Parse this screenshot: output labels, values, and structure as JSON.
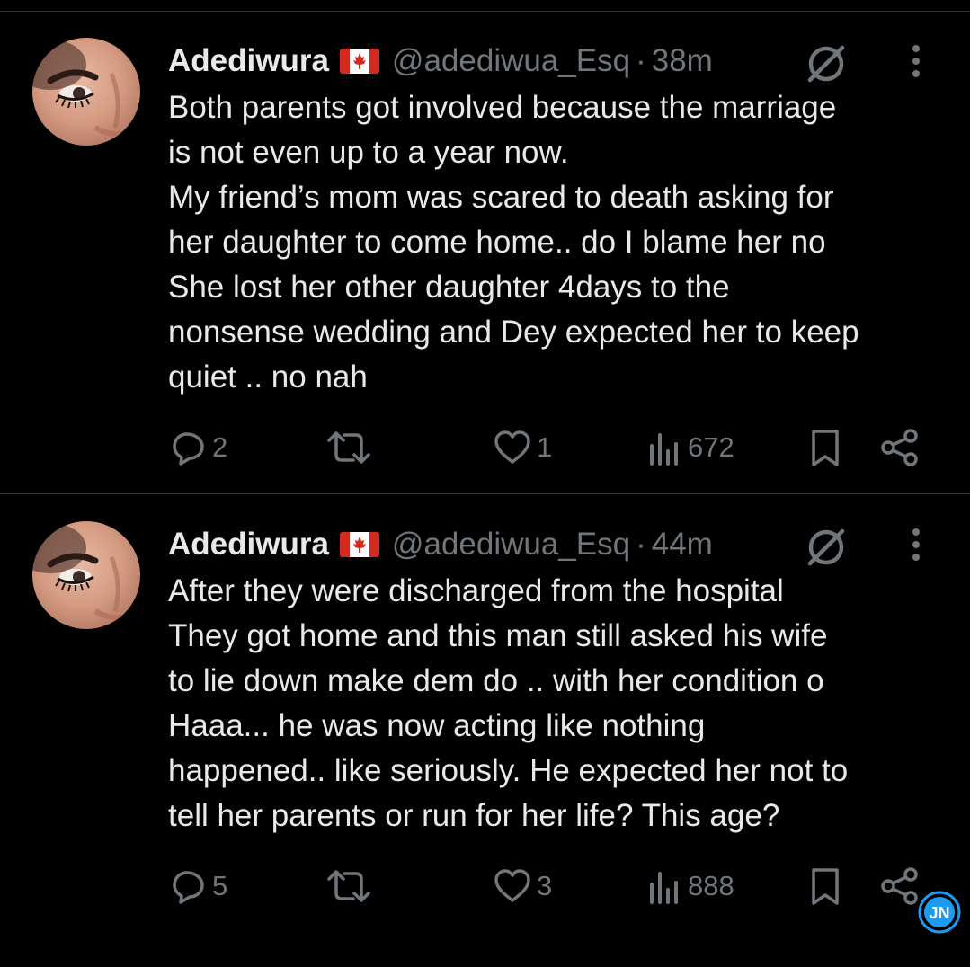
{
  "tweets": [
    {
      "author_name": "Adediwura",
      "flag": "canada-flag-icon",
      "handle": "@adediwua_Esq",
      "separator": "·",
      "time": "38m",
      "lines": [
        "Both parents got involved because the marriage",
        "is not even up to a year now.",
        "My friend’s mom was scared to death asking for",
        "her daughter to come home.. do I blame her no",
        "She lost her other daughter 4days to the",
        "nonsense wedding and Dey expected her to keep",
        "quiet .. no nah"
      ],
      "replies": "2",
      "retweets": "",
      "likes": "1",
      "views": "672"
    },
    {
      "author_name": "Adediwura",
      "flag": "canada-flag-icon",
      "handle": "@adediwua_Esq",
      "separator": "·",
      "time": "44m",
      "lines": [
        "After they were discharged from the hospital",
        "They got home and this man still asked his wife",
        "to lie down make dem do .. with her condition o",
        "Haaa... he was now acting like nothing",
        "happened.. like seriously. He expected her not to",
        "tell her parents or run for her life? This age?"
      ],
      "replies": "5",
      "retweets": "",
      "likes": "3",
      "views": "888"
    }
  ],
  "watermark": {
    "text": "JN",
    "icon": "jn-logo-icon"
  },
  "colors": {
    "background": "#000000",
    "text": "#e7e9ea",
    "muted": "#71767b",
    "divider": "#2f3336",
    "watermark": "#1d9bf0"
  }
}
